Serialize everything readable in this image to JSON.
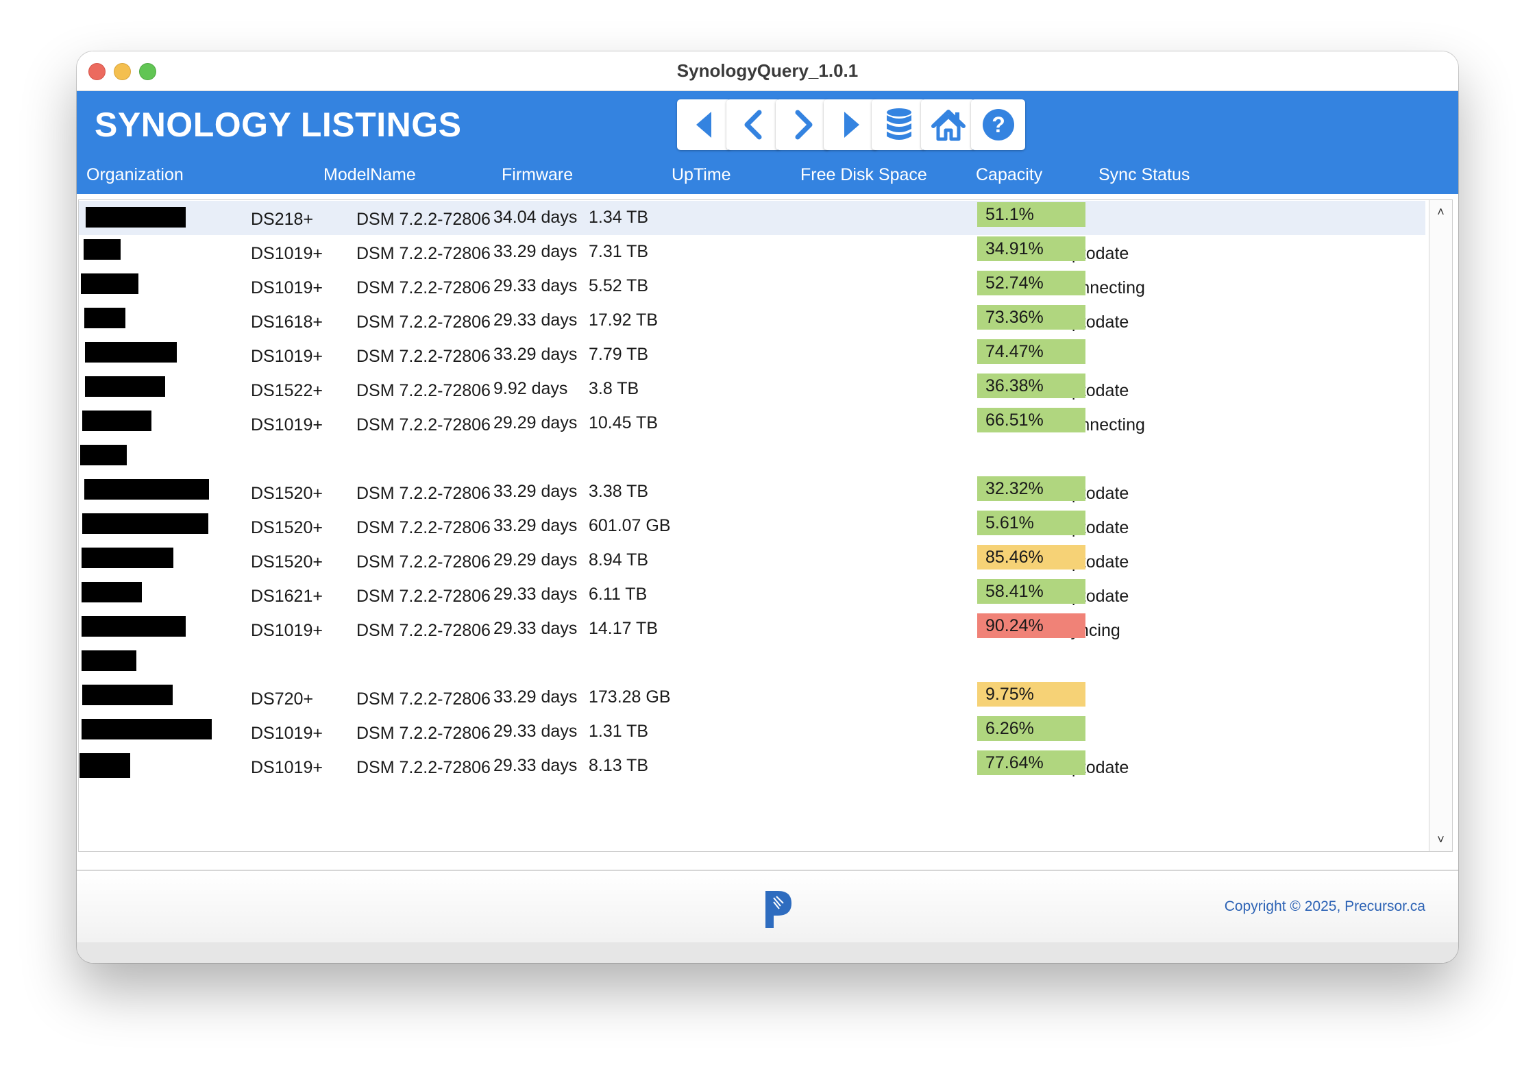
{
  "window": {
    "title": "SynologyQuery_1.0.1"
  },
  "header": {
    "title": "SYNOLOGY LISTINGS",
    "buttons": [
      {
        "name": "first-record-button",
        "icon": "triangle-left-icon"
      },
      {
        "name": "previous-record-button",
        "icon": "chevron-left-icon"
      },
      {
        "name": "next-record-button",
        "icon": "chevron-right-icon"
      },
      {
        "name": "last-record-button",
        "icon": "triangle-right-icon"
      },
      {
        "name": "database-button",
        "icon": "database-icon"
      },
      {
        "name": "home-button",
        "icon": "home-icon"
      },
      {
        "name": "help-button",
        "icon": "help-icon"
      }
    ]
  },
  "columns": {
    "organization": "Organization",
    "model": "ModelName",
    "firmware": "Firmware",
    "uptime": "UpTime",
    "free": "Free Disk Space",
    "capacity": "Capacity",
    "sync": "Sync Status"
  },
  "colors": {
    "header_bg": "#3483e0",
    "cap_green": "#b0d67f",
    "cap_yellow": "#f6d276",
    "cap_red": "#f08277"
  },
  "rows": [
    {
      "model": "DS218+",
      "firmware": "DSM 7.2.2-72806",
      "uptime": "34.04 days",
      "free": "1.34 TB",
      "capacity": "51.1%",
      "level": "green",
      "sync": ""
    },
    {
      "model": "DS1019+",
      "firmware": "DSM 7.2.2-72806",
      "uptime": "33.29 days",
      "free": "7.31 TB",
      "capacity": "34.91%",
      "level": "green",
      "sync": "uptodate"
    },
    {
      "model": "DS1019+",
      "firmware": "DSM 7.2.2-72806",
      "uptime": "29.33 days",
      "free": "5.52 TB",
      "capacity": "52.74%",
      "level": "green",
      "sync": "connecting"
    },
    {
      "model": "DS1618+",
      "firmware": "DSM 7.2.2-72806",
      "uptime": "29.33 days",
      "free": "17.92 TB",
      "capacity": "73.36%",
      "level": "green",
      "sync": "uptodate"
    },
    {
      "model": "DS1019+",
      "firmware": "DSM 7.2.2-72806",
      "uptime": "33.29 days",
      "free": "7.79 TB",
      "capacity": "74.47%",
      "level": "green",
      "sync": ""
    },
    {
      "model": "DS1522+",
      "firmware": "DSM 7.2.2-72806",
      "uptime": "9.92 days",
      "free": "3.8 TB",
      "capacity": "36.38%",
      "level": "green",
      "sync": "uptodate"
    },
    {
      "model": "DS1019+",
      "firmware": "DSM 7.2.2-72806",
      "uptime": "29.29 days",
      "free": "10.45 TB",
      "capacity": "66.51%",
      "level": "green",
      "sync": "connecting"
    },
    {
      "model": "",
      "firmware": "",
      "uptime": "",
      "free": "",
      "capacity": "",
      "level": "",
      "sync": ""
    },
    {
      "model": "DS1520+",
      "firmware": "DSM 7.2.2-72806",
      "uptime": "33.29 days",
      "free": "3.38 TB",
      "capacity": "32.32%",
      "level": "green",
      "sync": "uptodate"
    },
    {
      "model": "DS1520+",
      "firmware": "DSM 7.2.2-72806",
      "uptime": "33.29 days",
      "free": "601.07 GB",
      "capacity": "5.61%",
      "level": "green",
      "sync": "uptodate"
    },
    {
      "model": "DS1520+",
      "firmware": "DSM 7.2.2-72806",
      "uptime": "29.29 days",
      "free": "8.94 TB",
      "capacity": "85.46%",
      "level": "yellow",
      "sync": "uptodate"
    },
    {
      "model": "DS1621+",
      "firmware": "DSM 7.2.2-72806",
      "uptime": "29.33 days",
      "free": "6.11 TB",
      "capacity": "58.41%",
      "level": "green",
      "sync": "uptodate"
    },
    {
      "model": "DS1019+",
      "firmware": "DSM 7.2.2-72806",
      "uptime": "29.33 days",
      "free": "14.17 TB",
      "capacity": "90.24%",
      "level": "red",
      "sync": "syncing"
    },
    {
      "model": "",
      "firmware": "",
      "uptime": "",
      "free": "",
      "capacity": "",
      "level": "",
      "sync": ""
    },
    {
      "model": "DS720+",
      "firmware": "DSM 7.2.2-72806",
      "uptime": "33.29 days",
      "free": "173.28 GB",
      "capacity": "9.75%",
      "level": "yellow",
      "sync": ""
    },
    {
      "model": "DS1019+",
      "firmware": "DSM 7.2.2-72806",
      "uptime": "29.33 days",
      "free": "1.31 TB",
      "capacity": "6.26%",
      "level": "green",
      "sync": ""
    },
    {
      "model": "DS1019+",
      "firmware": "DSM 7.2.2-72806",
      "uptime": "29.33 days",
      "free": "8.13 TB",
      "capacity": "77.64%",
      "level": "green",
      "sync": "uptodate"
    }
  ],
  "footer": {
    "copyright": "Copyright © 2025, Precursor.ca",
    "logo_icon": "precursor-logo-icon"
  }
}
